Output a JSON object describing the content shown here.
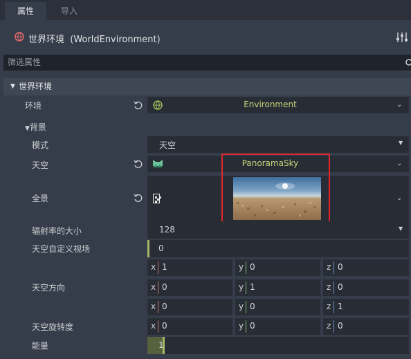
{
  "tabs": [
    {
      "label": "属性"
    },
    {
      "label": "导入"
    }
  ],
  "header": {
    "title": "世界环境  (WorldEnvironment)",
    "settings_icon": "sliders-icon"
  },
  "filter": {
    "placeholder": "筛选属性",
    "icon": "search-icon"
  },
  "section": {
    "label": "世界环境"
  },
  "environment": {
    "label": "环境",
    "value": "Environment"
  },
  "background": {
    "label": "背景",
    "mode": {
      "label": "模式",
      "value": "天空"
    },
    "sky": {
      "label": "天空",
      "value": "PanoramaSky"
    },
    "panorama": {
      "label": "全景"
    },
    "radiance_size": {
      "label": "辐射率的大小",
      "value": "128"
    },
    "custom_fov": {
      "label": "天空自定义视场",
      "value": "0"
    },
    "orientation": {
      "label": "天空方向",
      "rows": [
        [
          {
            "axis": "x",
            "value": "1"
          },
          {
            "axis": "y",
            "value": "0"
          },
          {
            "axis": "z",
            "value": "0"
          }
        ],
        [
          {
            "axis": "x",
            "value": "0"
          },
          {
            "axis": "y",
            "value": "1"
          },
          {
            "axis": "z",
            "value": "0"
          }
        ],
        [
          {
            "axis": "x",
            "value": "0"
          },
          {
            "axis": "y",
            "value": "0"
          },
          {
            "axis": "z",
            "value": "1"
          }
        ]
      ]
    },
    "rotation": {
      "label": "天空旋转度",
      "values": [
        {
          "axis": "x",
          "value": "0"
        },
        {
          "axis": "y",
          "value": "0"
        },
        {
          "axis": "z",
          "value": "0"
        }
      ]
    },
    "energy": {
      "label": "能量",
      "value": "1"
    }
  },
  "colors": {
    "highlight_box": "#e0262c",
    "axis_x": "#c8776a",
    "axis_y": "#7dbb6a",
    "axis_z": "#6a8ec8",
    "resource_text": "#c9d67a"
  }
}
